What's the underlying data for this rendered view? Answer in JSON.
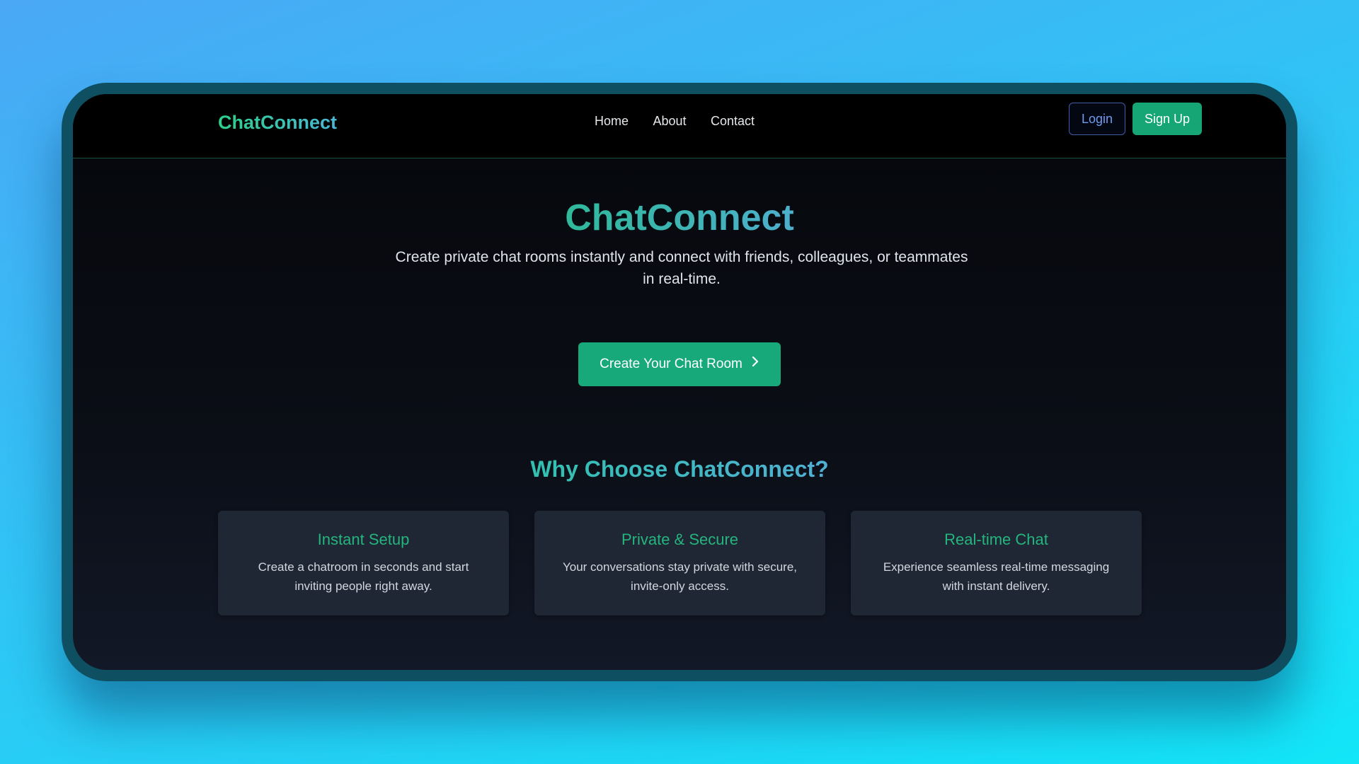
{
  "navbar": {
    "logo": "ChatConnect",
    "links": [
      "Home",
      "About",
      "Contact"
    ],
    "login_label": "Login",
    "signup_label": "Sign Up"
  },
  "hero": {
    "title": "ChatConnect",
    "subtitle": "Create private chat rooms instantly and connect with friends, colleagues, or teammates in real-time.",
    "cta_label": "Create Your Chat Room",
    "cta_icon": "chevron-right-icon"
  },
  "features": {
    "title": "Why Choose ChatConnect?",
    "cards": [
      {
        "title": "Instant Setup",
        "description": "Create a chatroom in seconds and start inviting people right away."
      },
      {
        "title": "Private & Secure",
        "description": "Your conversations stay private with secure, invite-only access."
      },
      {
        "title": "Real-time Chat",
        "description": "Experience seamless real-time messaging with instant delivery."
      }
    ]
  },
  "colors": {
    "accent_green": "#16a574",
    "heading_teal": "#3fb3b2",
    "card_bg": "#1f2634",
    "page_bg": "#05070b",
    "backdrop": "#2ec6f5"
  }
}
